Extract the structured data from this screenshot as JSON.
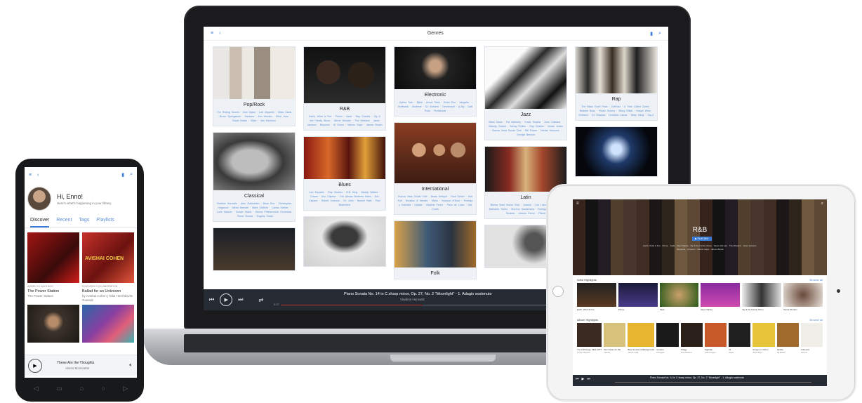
{
  "laptop": {
    "title": "Genres",
    "menu_icon": "≡",
    "back_icon": "‹",
    "bookmark_icon": "▮",
    "search_icon": "⌕",
    "genres": [
      {
        "name": "Pop/Rock",
        "artists": "The Rolling Stones · Bob Dylan · Led Zeppelin · Miles Davis · Bruce Springsteen · Santana · Jimi Hendrix · Elton John · David Bowie · Björk · Van Morrison"
      },
      {
        "name": "Classical",
        "artists": "Vladimir Horowitz · Artur Rubinstein · Brian Eno · Christopher Hogwood · Alfred Brendel · Miles Oldfield · Carlos Kleiber · Lorin Maazel · Gunter Wand · Vienna Philharmonic Orchestra · Pierre Boulez · Evgeny Kissin"
      },
      {
        "name": "R&B",
        "artists": "Earth, Wind & Fire · Prince · Sade · Ray Charles · Sly & the Family Stone · Stevie Wonder · The Weeknd · Janet Jackson · Beyoncé · Al Green · Marvin Gaye · James Brown"
      },
      {
        "name": "Blues",
        "artists": "Led Zeppelin · Ray Charles · B.B. King · Muddy Waters · Cream · Eric Clapton · The Allman Brothers Band · Eric Clapton · Robert Johnson · Dr. John · Bonnie Raitt · Paul Butterfield"
      },
      {
        "name": "Electronic",
        "artists": "Aphex Twin · Björk · Arnon Tobin · Brian Eno · Vangelis · Kraftwerk · Moderat · DJ Shadow · Deadmau5 · p-Zig · Daft Punk · Portishead"
      },
      {
        "name": "International",
        "artists": "Buena Vista Social Club · Beats Antique · Paul Simon · Kila Kuti · Amadou & Mariam · Mano · Youssou N'Dour · Rodrigo y Gabriela · Ojibwa · Vladimir Ferrer · Paco de Lucia · Gal Costa"
      },
      {
        "name": "Jazz",
        "artists": "Miles Davis · Pat Metheny · Frank Sinatra · John Coltrane · Melody Gardot · Sonny Rollins · Ray Charles · Norah Jones · Buena Vista Social Club · Bill Evans · Herbie Hancock · George Benson"
      },
      {
        "name": "Latin",
        "artists": "Buena Vista Social Club · Juanes · Los Lobos · Camila · Barbarito Torres · Moreno Santamaria · Rodrigo y Gabriela · Shakira · Vicente Ferrer · Pitbull"
      },
      {
        "name": "Rap",
        "artists": "The Black Eyed Peas · OutKast · A Tribe Called Quest · Beastie Boys · Public Enemy · Missy Elliott · Kanye West · Eminem · DJ Shadow · Kendrick Lamar · Nelly Minaj · Jay-Z"
      },
      {
        "name": "Folk",
        "artists": ""
      }
    ],
    "player": {
      "title": "Piano Sonata No. 14 in C sharp minor, Op. 27, No. 2 \"Moonlight\" - 1. Adagio sostenuto",
      "artist": "Vladimir Horowitz",
      "elapsed": "0:27",
      "progress": 0.42
    }
  },
  "phone": {
    "greeting": "Hi, Enno!",
    "subtitle": "Here's what's happening in your library.",
    "tabs": [
      "Discover",
      "Recent",
      "Tags",
      "Playlists"
    ],
    "tiles": [
      {
        "meta": "ADDED 13 DAYS AGO",
        "title": "The Power Station",
        "artist": "The Power Station",
        "bg": "#a11614"
      },
      {
        "meta": "FEATURED COLLABORATION",
        "title": "Ballad for an Unknown",
        "artist": "by Avishai Cohen | Nitai Hershkovits",
        "extra": "Guande",
        "bg": "#c7312a"
      },
      {
        "meta": "",
        "title": "",
        "artist": "",
        "bg": "#54493f"
      },
      {
        "meta": "",
        "title": "",
        "artist": "",
        "bg": "#3f7fb8"
      }
    ],
    "album_text": "AVISHAI COHEN",
    "player": {
      "title": "These Are the Thoughts",
      "artist": "Alanis Morissette"
    },
    "nav": [
      "◁",
      "▭",
      "⌂",
      "○",
      "▷"
    ]
  },
  "tablet": {
    "genre": "R&B",
    "badge": "▶ PLAY MIX",
    "desc": "Earth, Wind & Fire · Prince · Sade · Ray Charles · Sly & the Family Stone · Stevie Wonder · The Weeknd · Janet Jackson · Beyoncé · Al Green · Marvin Gaye · James Brown",
    "artist_section": "Artist Highlights",
    "album_section": "Album Highlights",
    "browse_label": "Browse all",
    "artists": [
      "Earth, Wind & Fire",
      "Prince",
      "Sade",
      "Ray Charles",
      "Sly & the Family Stone",
      "Stevie Wonder"
    ],
    "albums": [
      {
        "t": "The Anthology: 1961-1977",
        "s": "Curtis Mayfield"
      },
      {
        "t": "Don't Hate On Me",
        "s": "Various"
      },
      {
        "t": "Blue Sounds & Backgrounds",
        "s": "Jamie Lidell"
      },
      {
        "t": "Voodoo",
        "s": "D'Angelo"
      },
      {
        "t": "Trilogy",
        "s": "The Weeknd"
      },
      {
        "t": "Nightfall",
        "s": "Little Dragon"
      },
      {
        "t": "21",
        "s": "Adele"
      },
      {
        "t": "Songs in A Minor",
        "s": "Alicia Keys"
      },
      {
        "t": "Riptide",
        "s": "Taj Mahal"
      },
      {
        "t": "Unknown",
        "s": "Various"
      }
    ],
    "player": "Piano Sonata No. 14 in C sharp minor, Op. 27, No. 2 \"Moonlight\" - 1. Adagio sostenuto"
  }
}
